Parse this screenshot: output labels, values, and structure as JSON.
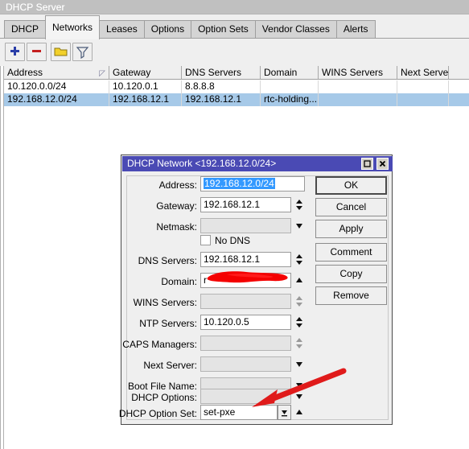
{
  "window": {
    "title": "DHCP Server",
    "tabs": [
      {
        "label": "DHCP",
        "active": false
      },
      {
        "label": "Networks",
        "active": true
      },
      {
        "label": "Leases",
        "active": false
      },
      {
        "label": "Options",
        "active": false
      },
      {
        "label": "Option Sets",
        "active": false
      },
      {
        "label": "Vendor Classes",
        "active": false
      },
      {
        "label": "Alerts",
        "active": false
      }
    ],
    "toolbar": [
      {
        "name": "add-button",
        "icon": "plus-icon",
        "color": "#2a3ea8"
      },
      {
        "name": "remove-button",
        "icon": "minus-icon",
        "color": "#c41f1f"
      },
      {
        "name": "enable-button",
        "icon": "folder-icon",
        "color": "#f2d02a"
      },
      {
        "name": "filter-button",
        "icon": "funnel-icon",
        "color": "#5a6e8c"
      }
    ]
  },
  "table": {
    "columns": [
      "Address",
      "Gateway",
      "DNS Servers",
      "Domain",
      "WINS Servers",
      "Next Server"
    ],
    "sort_column": "Address",
    "sort_indicator": "ascending",
    "rows": [
      {
        "selected": false,
        "cells": [
          "10.120.0.0/24",
          "10.120.0.1",
          "8.8.8.8",
          "",
          "",
          ""
        ]
      },
      {
        "selected": true,
        "cells": [
          "192.168.12.0/24",
          "192.168.12.1",
          "192.168.12.1",
          "rtc-holding....",
          "",
          ""
        ]
      }
    ]
  },
  "dialog": {
    "title": "DHCP Network <192.168.12.0/24>",
    "window_controls": [
      {
        "name": "maximize-button",
        "icon": "maximize-icon"
      },
      {
        "name": "close-button",
        "icon": "close-icon"
      }
    ],
    "fields": [
      {
        "label": "Address:",
        "value": "192.168.12.0/24",
        "selected_text": true,
        "disabled": false,
        "control": "none"
      },
      {
        "label": "Gateway:",
        "value": "192.168.12.1",
        "selected_text": false,
        "disabled": false,
        "control": "spinner"
      },
      {
        "label": "Netmask:",
        "value": "",
        "selected_text": false,
        "disabled": true,
        "control": "dropdown-arrow"
      },
      {
        "label": "DNS Servers:",
        "value": "192.168.12.1",
        "selected_text": false,
        "disabled": false,
        "control": "spinner"
      },
      {
        "label": "Domain:",
        "value": "r",
        "selected_text": false,
        "disabled": false,
        "control": "up-arrow",
        "redacted": true
      },
      {
        "label": "WINS Servers:",
        "value": "",
        "selected_text": false,
        "disabled": true,
        "control": "spinner"
      },
      {
        "label": "NTP Servers:",
        "value": "10.120.0.5",
        "selected_text": false,
        "disabled": false,
        "control": "spinner"
      },
      {
        "label": "CAPS Managers:",
        "value": "",
        "selected_text": false,
        "disabled": true,
        "control": "spinner"
      },
      {
        "label": "Next Server:",
        "value": "",
        "selected_text": false,
        "disabled": true,
        "control": "dropdown-arrow"
      },
      {
        "label": "Boot File Name:",
        "value": "",
        "selected_text": false,
        "disabled": true,
        "control": "dropdown-arrow"
      },
      {
        "label": "DHCP Options:",
        "value": "",
        "selected_text": false,
        "disabled": true,
        "control": "dropdown-arrow"
      },
      {
        "label": "DHCP Option Set:",
        "value": "set-pxe",
        "selected_text": false,
        "disabled": false,
        "control": "dropdown-button"
      }
    ],
    "checkbox": {
      "label": "No DNS",
      "checked": false
    },
    "buttons": [
      {
        "label": "OK",
        "default": true
      },
      {
        "label": "Cancel",
        "default": false
      },
      {
        "label": "Apply",
        "default": false
      },
      {
        "label": "Comment",
        "default": false
      },
      {
        "label": "Copy",
        "default": false
      },
      {
        "label": "Remove",
        "default": false
      }
    ]
  },
  "annotations": {
    "redaction_color": "#f40000",
    "arrow_color": "#e01b1b",
    "arrow_target": "DHCP Option Set"
  },
  "colors": {
    "title_bar": "#c0c0c0",
    "dialog_title_bar": "#4a4ab4",
    "selection_blue": "#a6c9e8",
    "text_selection": "#3399ff",
    "panel": "#efefef"
  }
}
